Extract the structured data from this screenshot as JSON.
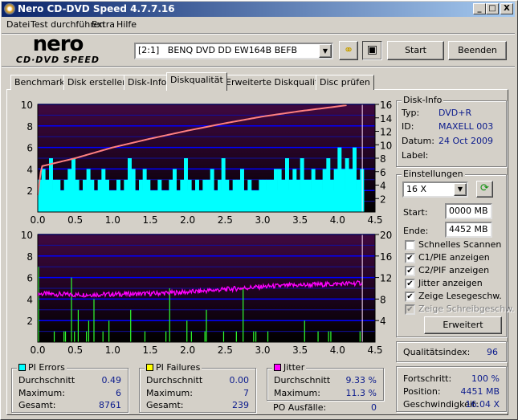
{
  "window": {
    "title": "Nero CD-DVD Speed 4.7.7.16",
    "minimize": "_",
    "maximize": "□",
    "close": "X"
  },
  "menu": [
    "Datei",
    "Test durchführen",
    "Extra",
    "Hilfe"
  ],
  "toolbar": {
    "logo_top": "nero",
    "logo_bottom": "CD·DVD SPEED",
    "drive": "[2:1]   BENQ DVD DD EW164B BEFB",
    "start": "Start",
    "quit": "Beenden"
  },
  "tabs": [
    "Benchmark",
    "Disk erstellen",
    "Disk-Info",
    "Diskqualität",
    "Erweiterte Diskqualität",
    "Disc prüfen"
  ],
  "active_tab": 3,
  "disk_info": {
    "title": "Disk-Info",
    "type_label": "Typ:",
    "type": "DVD+R",
    "id_label": "ID:",
    "id": "MAXELL 003",
    "date_label": "Datum:",
    "date": "24 Oct 2009",
    "label_label": "Label:"
  },
  "settings": {
    "title": "Einstellungen",
    "speed": "16 X",
    "start_label": "Start:",
    "start": "0000 MB",
    "end_label": "Ende:",
    "end": "4452 MB",
    "checks": [
      {
        "label": "Schnelles Scannen",
        "checked": false,
        "enabled": true
      },
      {
        "label": "C1/PIE anzeigen",
        "checked": true,
        "enabled": true
      },
      {
        "label": "C2/PIF anzeigen",
        "checked": true,
        "enabled": true
      },
      {
        "label": "Jitter anzeigen",
        "checked": true,
        "enabled": true
      },
      {
        "label": "Zeige Lesegeschw.",
        "checked": true,
        "enabled": true
      },
      {
        "label": "Zeige Schreibgeschw.",
        "checked": true,
        "enabled": false
      }
    ],
    "advanced": "Erweitert"
  },
  "quality": {
    "label": "Qualitätsindex:",
    "value": "96"
  },
  "progress": {
    "progress_label": "Fortschritt:",
    "progress": "100 %",
    "position_label": "Position:",
    "position": "4451 MB",
    "speed_label": "Geschwindigkeit:",
    "speed": "16.04 X"
  },
  "pi_errors": {
    "title": "PI Errors",
    "color": "#00ffff",
    "avg_label": "Durchschnitt",
    "avg": "0.49",
    "max_label": "Maximum:",
    "max": "6",
    "total_label": "Gesamt:",
    "total": "8761"
  },
  "pi_failures": {
    "title": "PI Failures",
    "color": "#ffff00",
    "avg_label": "Durchschnitt",
    "avg": "0.00",
    "max_label": "Maximum:",
    "max": "7",
    "total_label": "Gesamt:",
    "total": "239"
  },
  "jitter": {
    "title": "Jitter",
    "color": "#ff00ff",
    "avg_label": "Durchschnitt",
    "avg": "9.33 %",
    "max_label": "Maximum:",
    "max": "11.3 %",
    "po_label": "PO Ausfälle:",
    "po": "0"
  },
  "chart_data": [
    {
      "type": "bar",
      "name": "PI Errors / read speed",
      "xlim": [
        0,
        4.5
      ],
      "ylim": [
        0,
        10
      ],
      "y2lim": [
        0,
        16
      ],
      "xticks": [
        "0.0",
        "0.5",
        "1.0",
        "1.5",
        "2.0",
        "2.5",
        "3.0",
        "3.5",
        "4.0",
        "4.5"
      ],
      "yticks": [
        "2",
        "4",
        "6",
        "8",
        "10"
      ],
      "y2ticks": [
        "2",
        "4",
        "6",
        "8",
        "10",
        "12",
        "14",
        "16"
      ],
      "pi_step": 0.05,
      "pi_values": [
        3,
        4,
        3,
        5,
        3,
        3,
        2,
        3,
        4,
        5,
        3,
        2,
        3,
        4,
        3,
        2,
        3,
        4,
        3,
        2,
        2,
        3,
        2,
        3,
        5,
        4,
        2,
        3,
        4,
        3,
        2,
        2,
        3,
        2,
        2,
        3,
        4,
        2,
        3,
        5,
        3,
        2,
        3,
        2,
        3,
        3,
        4,
        2,
        3,
        5,
        3,
        2,
        3,
        3,
        4,
        2,
        3,
        2,
        2,
        3,
        3,
        3,
        3,
        4,
        4,
        3,
        5,
        3,
        4,
        3,
        5,
        3,
        3,
        4,
        3,
        3,
        4,
        5,
        3,
        4,
        6,
        4,
        5,
        4,
        6,
        3,
        4
      ],
      "speed_x": [
        0,
        0.05,
        0.5,
        1,
        1.5,
        2,
        2.5,
        3,
        3.5,
        4,
        4.13
      ],
      "speed_y": [
        2.5,
        6.8,
        8.0,
        9.6,
        10.9,
        12.1,
        13.2,
        14.2,
        15.0,
        15.7,
        15.9
      ],
      "end_marker": 4.33
    },
    {
      "type": "bar",
      "name": "PI Failures / jitter",
      "xlim": [
        0,
        4.5
      ],
      "ylim": [
        0,
        10
      ],
      "y2lim": [
        0,
        20
      ],
      "xticks": [
        "0.0",
        "0.5",
        "1.0",
        "1.5",
        "2.0",
        "2.5",
        "3.0",
        "3.5",
        "4.0",
        "4.5"
      ],
      "yticks": [
        "2",
        "4",
        "6",
        "8",
        "10"
      ],
      "y2ticks": [
        "4",
        "8",
        "12",
        "16",
        "20"
      ],
      "pif": [
        [
          0.01,
          7
        ],
        [
          0.22,
          1
        ],
        [
          0.35,
          1
        ],
        [
          0.37,
          1
        ],
        [
          0.45,
          6
        ],
        [
          0.49,
          1
        ],
        [
          0.54,
          3
        ],
        [
          0.65,
          1
        ],
        [
          0.68,
          2
        ],
        [
          0.75,
          4
        ],
        [
          0.87,
          1
        ],
        [
          0.95,
          2
        ],
        [
          1.24,
          3
        ],
        [
          1.43,
          1
        ],
        [
          1.71,
          1
        ],
        [
          1.76,
          5
        ],
        [
          1.99,
          2
        ],
        [
          2.05,
          1
        ],
        [
          2.23,
          1
        ],
        [
          2.25,
          3
        ],
        [
          2.48,
          1
        ],
        [
          2.65,
          1
        ],
        [
          2.74,
          5
        ],
        [
          2.88,
          1
        ],
        [
          2.91,
          1
        ],
        [
          3.07,
          1
        ],
        [
          3.56,
          2
        ],
        [
          3.74,
          1
        ],
        [
          3.88,
          1
        ],
        [
          3.91,
          1
        ],
        [
          4.3,
          1
        ]
      ],
      "jitter_x": [
        0,
        0.5,
        1,
        1.5,
        2,
        2.5,
        3,
        3.5,
        4,
        4.33
      ],
      "jitter_y": [
        9.0,
        8.8,
        8.9,
        9.0,
        9.3,
        9.8,
        10.3,
        10.6,
        10.8,
        11.0
      ],
      "end_marker": 4.33
    }
  ]
}
